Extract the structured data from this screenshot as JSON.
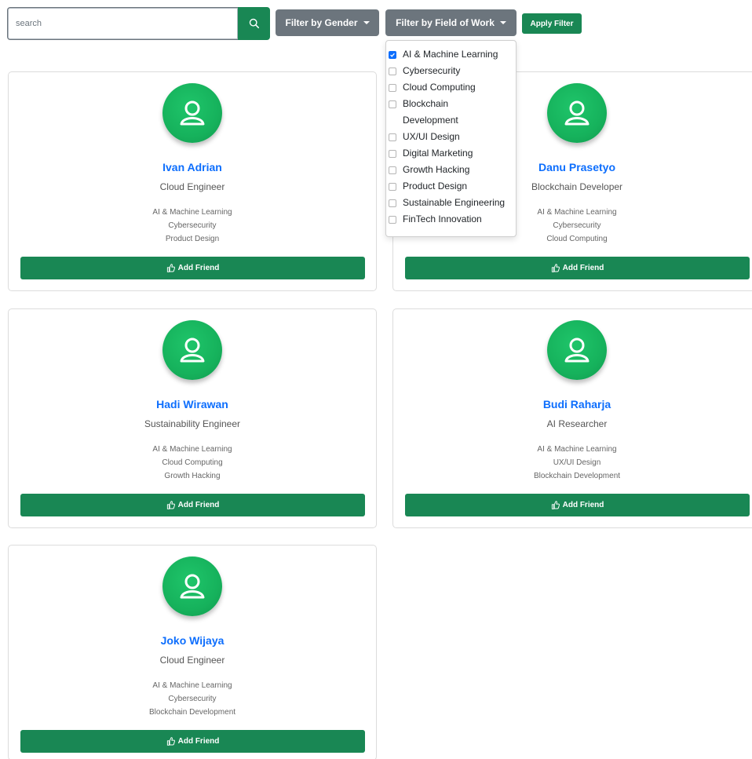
{
  "toolbar": {
    "search_placeholder": "search",
    "gender_label": "Filter by Gender",
    "field_label": "Filter by Field of Work",
    "apply_label": "Apply Filter"
  },
  "dropdown": {
    "items": [
      {
        "label": "AI & Machine Learning",
        "checked": true
      },
      {
        "label": "Cybersecurity",
        "checked": false
      },
      {
        "label": "Cloud Computing",
        "checked": false
      },
      {
        "label": "Blockchain Development",
        "checked": false
      },
      {
        "label": "UX/UI Design",
        "checked": false
      },
      {
        "label": "Digital Marketing",
        "checked": false
      },
      {
        "label": "Growth Hacking",
        "checked": false
      },
      {
        "label": "Product Design",
        "checked": false
      },
      {
        "label": "Sustainable Engineering",
        "checked": false
      },
      {
        "label": "FinTech Innovation",
        "checked": false
      }
    ]
  },
  "cards": [
    {
      "name": "Ivan Adrian",
      "role": "Cloud Engineer",
      "fields": [
        "AI & Machine Learning",
        "Cybersecurity",
        "Product Design"
      ],
      "button": "Add Friend"
    },
    {
      "name": "Danu Prasetyo",
      "role": "Blockchain Developer",
      "fields": [
        "AI & Machine Learning",
        "Cybersecurity",
        "Cloud Computing"
      ],
      "button": "Add Friend"
    },
    {
      "name": "Hadi Wirawan",
      "role": "Sustainability Engineer",
      "fields": [
        "AI & Machine Learning",
        "Cloud Computing",
        "Growth Hacking"
      ],
      "button": "Add Friend"
    },
    {
      "name": "Budi Raharja",
      "role": "AI Researcher",
      "fields": [
        "AI & Machine Learning",
        "UX/UI Design",
        "Blockchain Development"
      ],
      "button": "Add Friend"
    },
    {
      "name": "Joko Wijaya",
      "role": "Cloud Engineer",
      "fields": [
        "AI & Machine Learning",
        "Cybersecurity",
        "Blockchain Development"
      ],
      "button": "Add Friend"
    }
  ],
  "colors": {
    "primary_green": "#198754",
    "avatar_green": "#16b25c",
    "link_blue": "#0d6efd",
    "secondary_gray": "#6c757d"
  },
  "icons": {
    "search": "search-icon",
    "avatar": "user-icon",
    "add_friend": "thumbs-up-icon",
    "checkbox_checked": "check-icon"
  }
}
